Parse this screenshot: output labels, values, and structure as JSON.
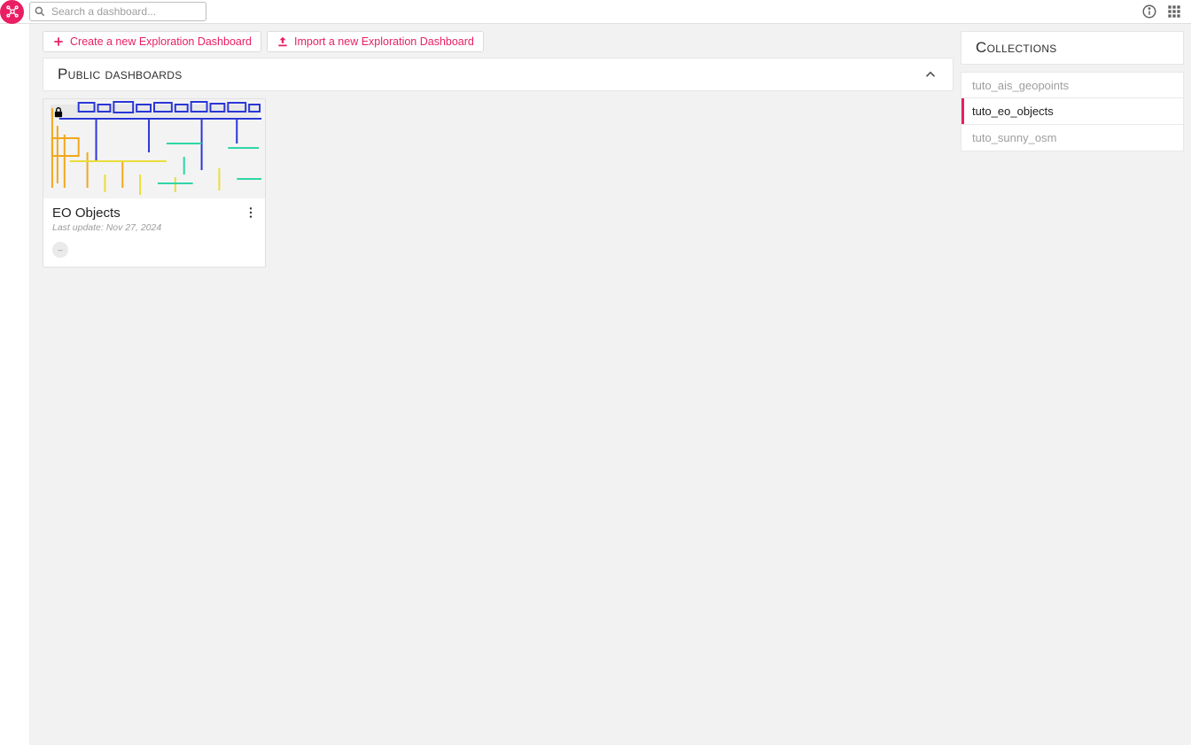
{
  "topbar": {
    "search_placeholder": "Search a dashboard..."
  },
  "actions": {
    "create_label": "Create a new Exploration Dashboard",
    "import_label": "Import a new Exploration Dashboard"
  },
  "section": {
    "title": "Public dashboards"
  },
  "cards": [
    {
      "title": "EO Objects",
      "meta": "Last update: Nov 27, 2024",
      "badge": "--"
    }
  ],
  "collections": {
    "title": "Collections",
    "items": [
      {
        "label": "tuto_ais_geopoints",
        "active": false
      },
      {
        "label": "tuto_eo_objects",
        "active": true
      },
      {
        "label": "tuto_sunny_osm",
        "active": false
      }
    ]
  },
  "colors": {
    "accent": "#e91e63"
  }
}
